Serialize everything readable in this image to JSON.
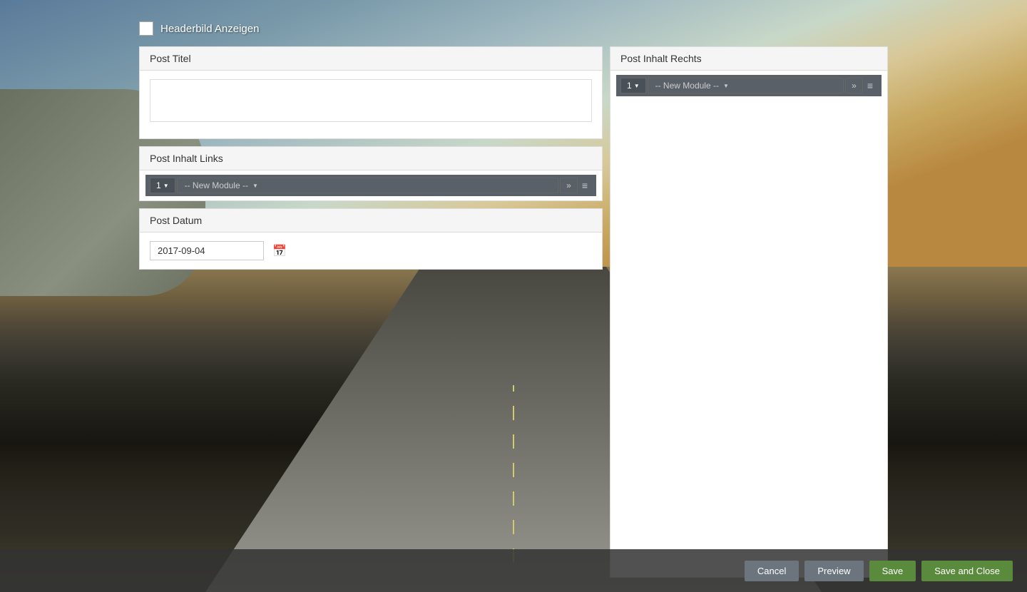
{
  "background": {
    "description": "Scenic road landscape background"
  },
  "header": {
    "checkbox_label": "Headerbild Anzeigen"
  },
  "left_panel": {
    "post_titel": {
      "label": "Post Titel",
      "textarea_value": "",
      "textarea_placeholder": ""
    },
    "post_inhalt_links": {
      "label": "Post Inhalt Links",
      "module_row": {
        "number": "1",
        "new_module_label": "-- New Module --",
        "forward_symbol": "»",
        "expand_symbol": "≡"
      }
    },
    "post_datum": {
      "label": "Post Datum",
      "date_value": "2017-09-04",
      "calendar_icon": "📅"
    }
  },
  "right_panel": {
    "post_inhalt_rechts": {
      "label": "Post Inhalt Rechts",
      "module_row": {
        "number": "1",
        "new_module_label": "-- New Module --",
        "forward_symbol": "»",
        "expand_symbol": "≡"
      }
    }
  },
  "action_bar": {
    "cancel_label": "Cancel",
    "preview_label": "Preview",
    "save_label": "Save",
    "save_close_label": "Save and Close"
  }
}
